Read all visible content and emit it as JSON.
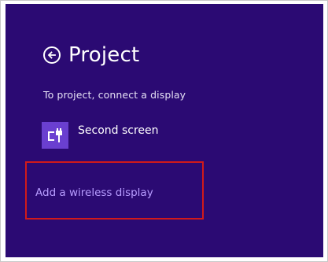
{
  "header": {
    "title": "Project"
  },
  "subtitle": "To project, connect a display",
  "options": [
    {
      "label": "Second screen",
      "icon": "second-screen-icon"
    }
  ],
  "wireless": {
    "label": "Add a wireless display",
    "highlight_color": "#d11a1a"
  },
  "colors": {
    "background": "#2b0a73",
    "tile": "#6a3fd0",
    "link": "#b79cff"
  }
}
